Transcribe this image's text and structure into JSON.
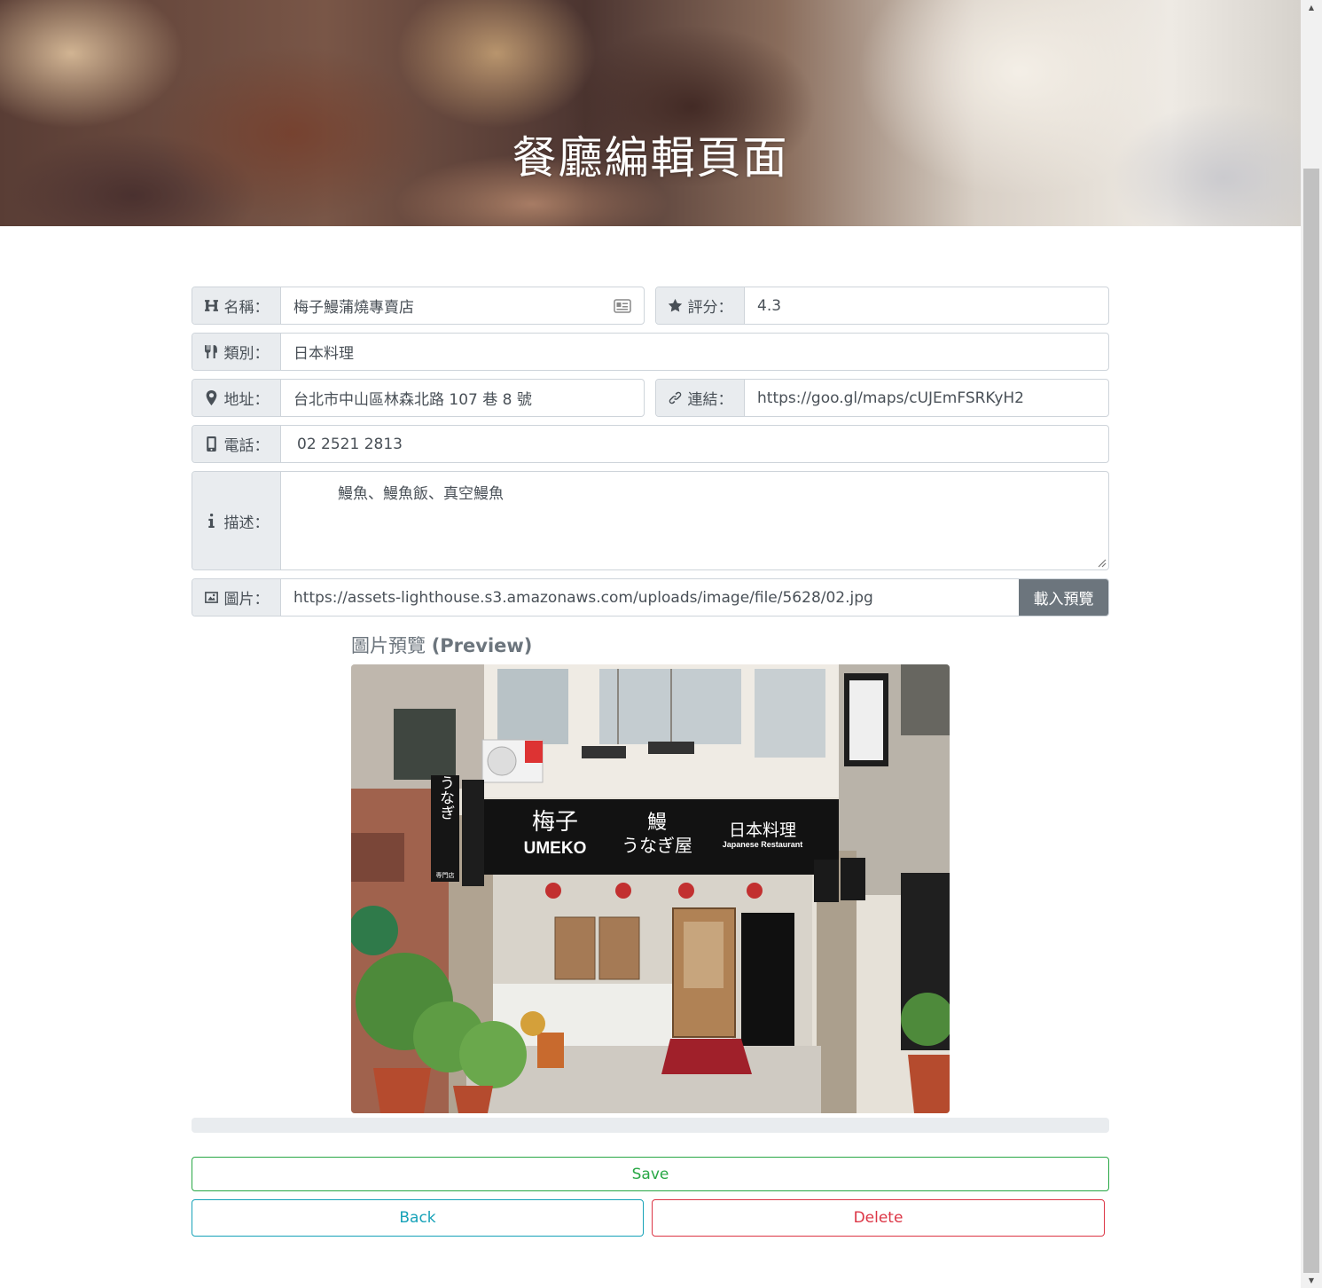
{
  "header": {
    "title": "餐廳編輯頁面"
  },
  "form": {
    "name": {
      "label": "名稱：",
      "value": "梅子鰻蒲燒專賣店",
      "icon": "heading-icon"
    },
    "rating": {
      "label": "評分：",
      "value": "4.3",
      "icon": "star-icon"
    },
    "category": {
      "label": "類別：",
      "value": "日本料理",
      "icon": "utensils-icon"
    },
    "address": {
      "label": "地址：",
      "value": "台北市中山區林森北路 107 巷 8 號",
      "icon": "map-marker-icon"
    },
    "link": {
      "label": "連結：",
      "value": "https://goo.gl/maps/cUJEmFSRKyH2",
      "icon": "link-icon"
    },
    "phone": {
      "label": "電話：",
      "value": "02 2521 2813",
      "icon": "mobile-icon"
    },
    "description": {
      "label": "描述：",
      "value": "鰻魚、鰻魚飯、真空鰻魚",
      "icon": "info-icon"
    },
    "image": {
      "label": "圖片：",
      "value": "https://assets-lighthouse.s3.amazonaws.com/uploads/image/file/5628/02.jpg",
      "icon": "image-icon",
      "load_button": "載入預覽"
    }
  },
  "preview": {
    "label": "圖片預覽",
    "label_en": "(Preview)",
    "signboard": {
      "name_jp": "梅子",
      "name_en": "UMEKO",
      "eel_kanji": "鰻",
      "eel_kana": "うなぎ屋",
      "cuisine_jp": "日本料理",
      "cuisine_en": "Japanese Restaurant",
      "side_sign": "うなぎ",
      "side_sign_small": "専門店"
    }
  },
  "actions": {
    "save": "Save",
    "back": "Back",
    "delete": "Delete"
  }
}
